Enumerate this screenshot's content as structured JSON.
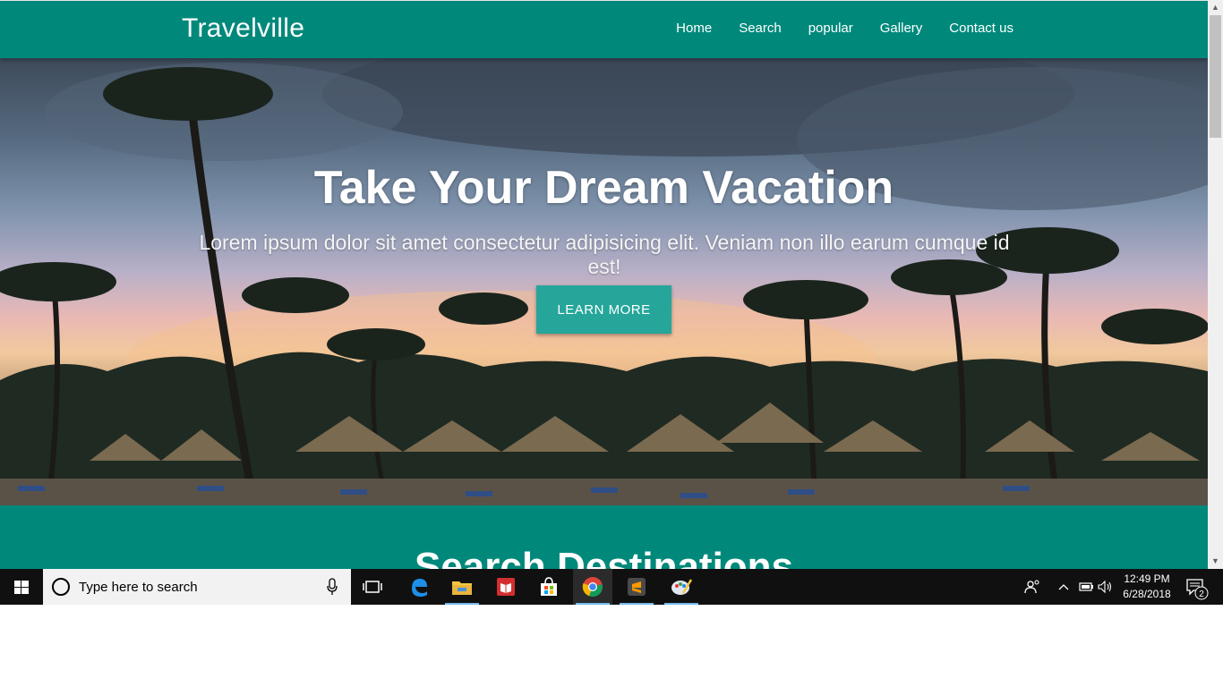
{
  "navbar": {
    "brand": "Travelville",
    "links": [
      "Home",
      "Search",
      "popular",
      "Gallery",
      "Contact us"
    ]
  },
  "hero": {
    "title": "Take Your Dream Vacation",
    "subtitle": "Lorem ipsum dolor sit amet consectetur adipisicing elit. Veniam non illo earum cumque id est!",
    "button": "LEARN MORE"
  },
  "search_section": {
    "title": "Search Destinations"
  },
  "colors": {
    "primary": "#00897b",
    "accent": "#26a69a",
    "taskbar": "#101010"
  },
  "taskbar": {
    "search_placeholder": "Type here to search",
    "apps": [
      "task-view-icon",
      "edge-icon",
      "file-explorer-icon",
      "reader-icon",
      "store-icon",
      "chrome-icon",
      "sublime-text-icon",
      "paint-icon"
    ],
    "time": "12:49 PM",
    "date": "6/28/2018",
    "notification_count": "2"
  }
}
